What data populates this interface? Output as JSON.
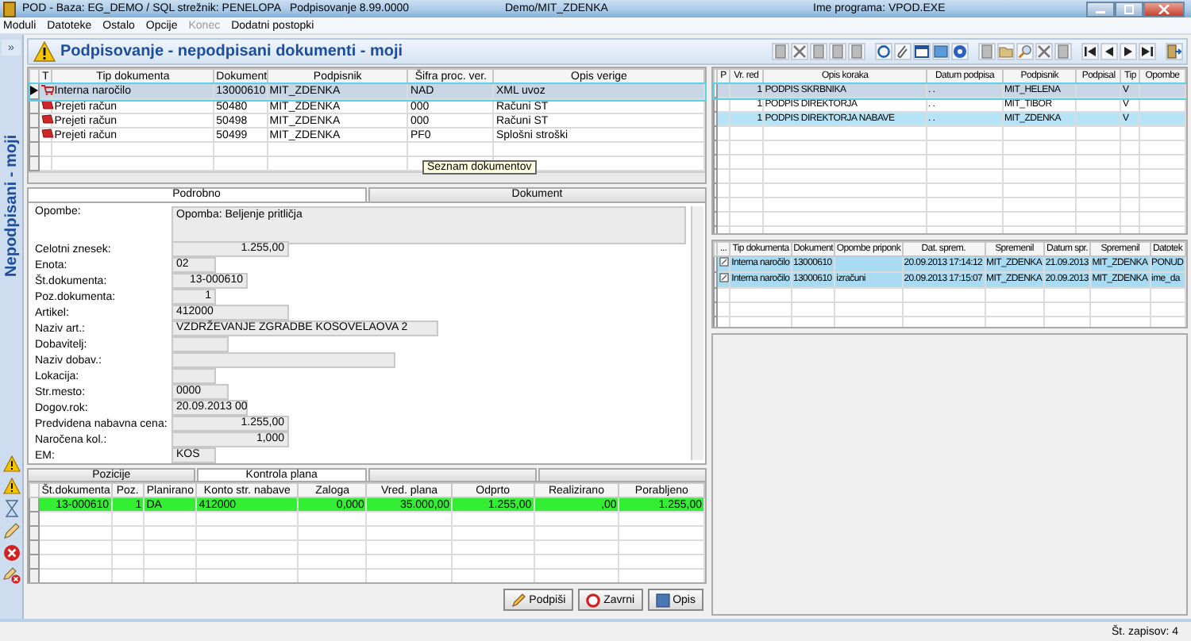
{
  "window": {
    "title": "POD - Baza: EG_DEMO / SQL strežnik: PENELOPA   Podpisovanje 8.99.0000",
    "user": "Demo/MIT_ZDENKA",
    "program": "Ime programa: VPOD.EXE"
  },
  "menu": [
    {
      "label": "Moduli",
      "disabled": false
    },
    {
      "label": "Datoteke",
      "disabled": false
    },
    {
      "label": "Ostalo",
      "disabled": false
    },
    {
      "label": "Opcije",
      "disabled": false
    },
    {
      "label": "Konec",
      "disabled": true
    },
    {
      "label": "Dodatni postopki",
      "disabled": false
    }
  ],
  "side": {
    "expand": "»",
    "title": "Nepodpisani - moji"
  },
  "header": {
    "title": "Podpisovanje - nepodpisani dokumenti - moji"
  },
  "documents": {
    "columns": [
      "T",
      "Tip dokumenta",
      "Dokument",
      "Podpisnik",
      "Šifra proc. ver.",
      "Opis verige"
    ],
    "tooltip": "Seznam dokumentov",
    "rows": [
      {
        "kind": "order",
        "selected": true,
        "cells": [
          "",
          "Interna naročilo",
          "13000610",
          "MIT_ZDENKA",
          "NAD",
          "XML uvoz"
        ]
      },
      {
        "kind": "invoice",
        "selected": false,
        "cells": [
          "",
          "Prejeti račun",
          "50480",
          "MIT_ZDENKA",
          "000",
          "Računi ST"
        ]
      },
      {
        "kind": "invoice",
        "selected": false,
        "cells": [
          "",
          "Prejeti račun",
          "50498",
          "MIT_ZDENKA",
          "000",
          "Računi ST"
        ]
      },
      {
        "kind": "invoice",
        "selected": false,
        "cells": [
          "",
          "Prejeti račun",
          "50499",
          "MIT_ZDENKA",
          "PF0",
          "Splošni stroški"
        ]
      }
    ]
  },
  "detail_tabs": [
    {
      "label": "Podrobno",
      "selected": true
    },
    {
      "label": "Dokument",
      "selected": false
    }
  ],
  "form": [
    {
      "label": "Opombe:",
      "kind": "memo",
      "value": "Opomba: Beljenje pritličja"
    },
    {
      "label": "Celotni znesek:",
      "kind": "number",
      "value": "1.255,00"
    },
    {
      "label": "Enota:",
      "kind": "text",
      "value": "02"
    },
    {
      "label": "Št.dokumenta:",
      "kind": "number",
      "value": "13-000610"
    },
    {
      "label": "Poz.dokumenta:",
      "kind": "number",
      "value": "1"
    },
    {
      "label": "Artikel:",
      "kind": "text",
      "value": "412000"
    },
    {
      "label": "Naziv art.:",
      "kind": "text",
      "value": "VZDRŽEVANJE ZGRADBE KOSOVELAOVA 2"
    },
    {
      "label": "Dobavitelj:",
      "kind": "text"
    },
    {
      "label": "Naziv dobav.:",
      "kind": "text"
    },
    {
      "label": "Lokacija:",
      "kind": "text"
    },
    {
      "label": "Str.mesto:",
      "kind": "text",
      "value": "0000"
    },
    {
      "label": "Dogov.rok:",
      "kind": "text",
      "value": "20.09.2013 00"
    },
    {
      "label": "Predvidena nabavna cena:",
      "kind": "number",
      "value": "1.255,00"
    },
    {
      "label": "Naročena kol.:",
      "kind": "number",
      "value": "1,000"
    },
    {
      "label": "EM:",
      "kind": "text",
      "value": "KOS"
    }
  ],
  "plan_tabs": [
    {
      "label": "Pozicije",
      "selected": false
    },
    {
      "label": "Kontrola plana",
      "selected": true
    },
    {
      "selected": false
    },
    {
      "selected": false
    }
  ],
  "plan": {
    "columns": [
      "Št.dokumenta",
      "Poz.",
      "Planirano",
      "Konto str. nabave",
      "Zaloga",
      "Vred. plana",
      "Odprto",
      "Realizirano",
      "Porabljeno"
    ],
    "rows": [
      {
        "color": "#33ee33",
        "cells": [
          "13-000610",
          "1",
          "DA",
          "412000",
          "0,000",
          "35.000,00",
          "1.255,00",
          ",00",
          "1.255,00"
        ]
      }
    ]
  },
  "buttons": [
    {
      "kind": "sign",
      "label": "Podpiši"
    },
    {
      "kind": "reject",
      "label": "Zavrni"
    },
    {
      "kind": "description",
      "label": "Opis"
    }
  ],
  "steps": {
    "columns": [
      "P",
      "Vr. red",
      "Opis koraka",
      "Datum podpisa",
      "Podpisnik",
      "Podpisal",
      "Tip",
      "Opombe"
    ],
    "rows": [
      {
        "current": true,
        "selected": false,
        "cells": [
          null,
          "1",
          "PODPIS SKRBNIKA",
          ". .",
          "MIT_HELENA",
          null,
          "V",
          null
        ]
      },
      {
        "current": false,
        "selected": false,
        "cells": [
          null,
          "1",
          "PODPIS DIREKTORJA",
          ". .",
          "MIT_TIBOR",
          null,
          "V",
          null
        ]
      },
      {
        "current": false,
        "selected": true,
        "cells": [
          null,
          "1",
          "PODPIS DIREKTORJA NABAVE",
          ". .",
          "MIT_ZDENKA",
          null,
          "V",
          null
        ]
      }
    ]
  },
  "attachments": {
    "columns": [
      "...",
      "Tip dokumenta",
      "Dokument",
      "Opombe priponk",
      "Dat. sprem.",
      "Spremenil",
      "Datum spr.",
      "Spremenil",
      "Datotek"
    ],
    "rows": [
      {
        "selected": true,
        "cells": [
          null,
          "Interna naročilo",
          "13000610",
          null,
          "20.09.2013 17:14:12",
          "MIT_ZDENKA",
          "21.09.2013",
          "MIT_ZDENKA",
          "PONUD"
        ]
      },
      {
        "selected": true,
        "cells": [
          null,
          "Interna naročilo",
          "13000610",
          "izračuni",
          "20.09.2013 17:15:07",
          "MIT_ZDENKA",
          "20.09.2013",
          "MIT_ZDENKA",
          "ime_da"
        ]
      }
    ]
  },
  "status_bar": {
    "records": "Št. zapisov: 4"
  }
}
